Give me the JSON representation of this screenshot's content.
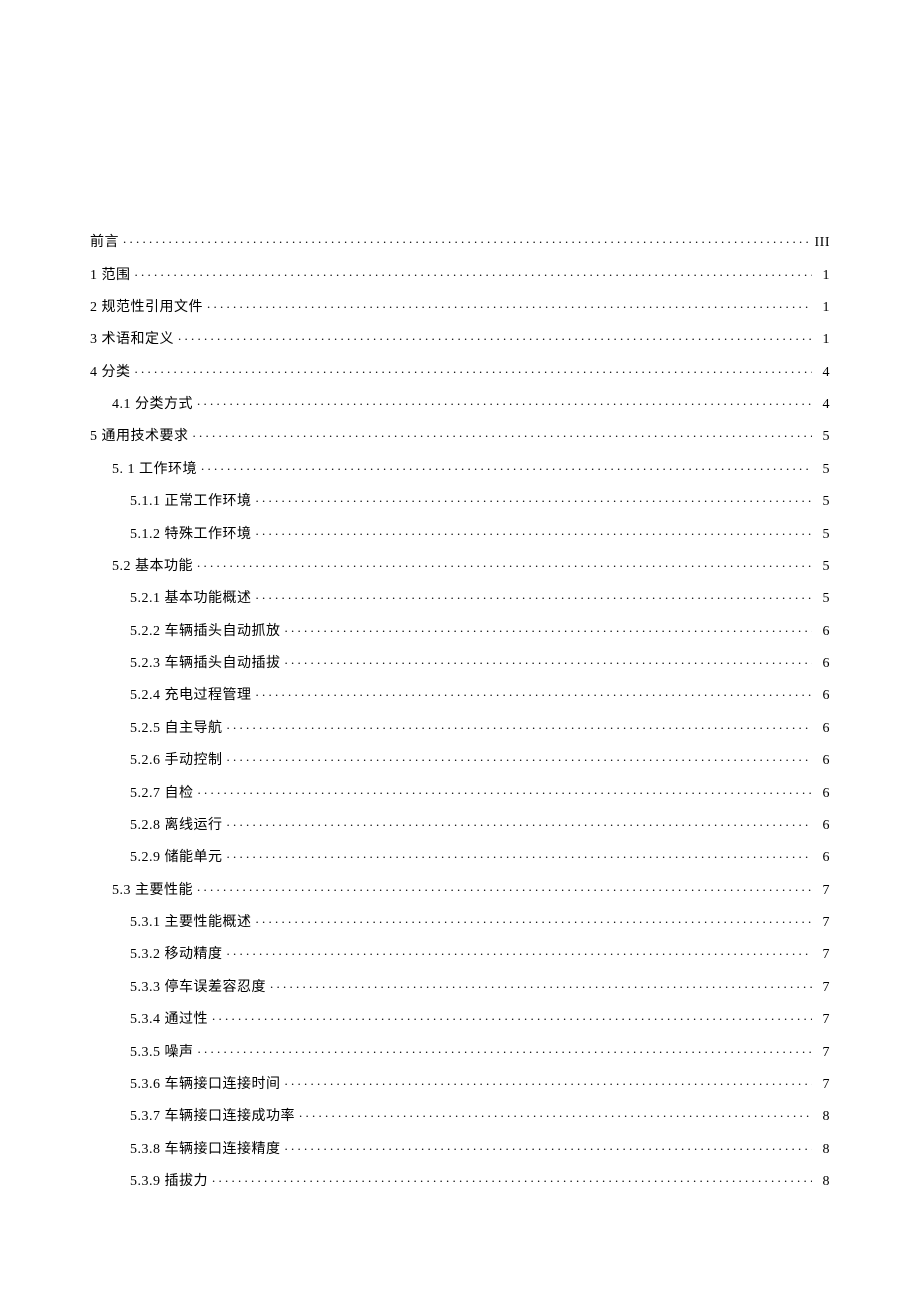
{
  "toc": [
    {
      "level": 0,
      "title": "前言",
      "page": "III"
    },
    {
      "level": 0,
      "title": "1 范围",
      "page": "1"
    },
    {
      "level": 0,
      "title": "2 规范性引用文件",
      "page": "1"
    },
    {
      "level": 0,
      "title": "3 术语和定义",
      "page": "1"
    },
    {
      "level": 0,
      "title": "4 分类",
      "page": "4"
    },
    {
      "level": 1,
      "title": "4.1 分类方式",
      "page": "4"
    },
    {
      "level": 0,
      "title": "5 通用技术要求",
      "page": "5"
    },
    {
      "level": 1,
      "title": "5.  1 工作环境",
      "page": "5"
    },
    {
      "level": 2,
      "title": "5.1.1     正常工作环境",
      "page": "5"
    },
    {
      "level": 2,
      "title": "5.1.2     特殊工作环境",
      "page": "5"
    },
    {
      "level": 1,
      "title": "5.2 基本功能",
      "page": "5"
    },
    {
      "level": 2,
      "title": "5.2.1 基本功能概述",
      "page": "5"
    },
    {
      "level": 2,
      "title": "5.2.2     车辆插头自动抓放",
      "page": "6"
    },
    {
      "level": 2,
      "title": "5.2.3     车辆插头自动插拔",
      "page": "6"
    },
    {
      "level": 2,
      "title": "5.2.4     充电过程管理",
      "page": "6"
    },
    {
      "level": 2,
      "title": "5.2.5 自主导航",
      "page": "6"
    },
    {
      "level": 2,
      "title": "5.2.6 手动控制",
      "page": "6"
    },
    {
      "level": 2,
      "title": "5.2.7 自检",
      "page": "6"
    },
    {
      "level": 2,
      "title": "5.2.8 离线运行",
      "page": "6"
    },
    {
      "level": 2,
      "title": "5.2.9 储能单元",
      "page": "6"
    },
    {
      "level": 1,
      "title": "5.3 主要性能",
      "page": "7"
    },
    {
      "level": 2,
      "title": "5.3.1 主要性能概述",
      "page": "7"
    },
    {
      "level": 2,
      "title": "5.3.2 移动精度",
      "page": "7"
    },
    {
      "level": 2,
      "title": "5.3.3 停车误差容忍度",
      "page": "7"
    },
    {
      "level": 2,
      "title": "5.3.4 通过性",
      "page": "7"
    },
    {
      "level": 2,
      "title": "5.3.5   噪声",
      "page": "7"
    },
    {
      "level": 2,
      "title": "5.3.6 车辆接口连接时间",
      "page": "7"
    },
    {
      "level": 2,
      "title": "5.3.7 车辆接口连接成功率",
      "page": "8"
    },
    {
      "level": 2,
      "title": "5.3.8 车辆接口连接精度",
      "page": "8"
    },
    {
      "level": 2,
      "title": "5.3.9 插拔力",
      "page": "8"
    }
  ]
}
